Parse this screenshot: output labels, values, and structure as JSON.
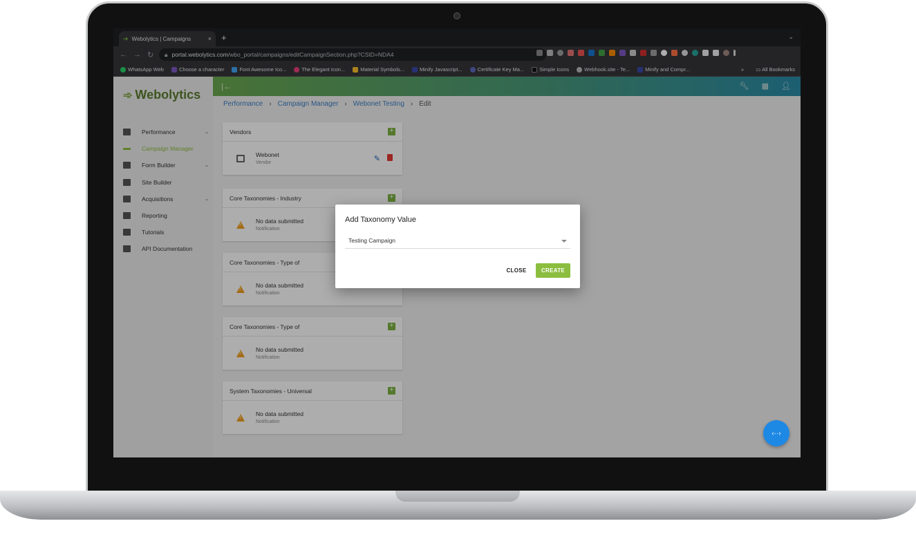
{
  "browser": {
    "tab_title": "Webolytics | Campaigns",
    "tab_close": "×",
    "new_tab": "+",
    "url_host": "portal.webolytics.com",
    "url_path": "/wbo_portal/campaigns/editCampaignSection.php?CSID=NDA4",
    "bookmarks": [
      "WhatsApp Web",
      "Choose a character",
      "Font Awesome Ico...",
      "The Elegant Icon...",
      "Material Symbols...",
      "Minify Javascript...",
      "Certificate Key Ma...",
      "Simple Icons",
      "Webhook.site - Te...",
      "Minify and Compr..."
    ],
    "all_bookmarks": "All Bookmarks",
    "bookmark_more": "»"
  },
  "app": {
    "logo": "Webolytics",
    "menu": [
      {
        "label": "Performance",
        "has_chevron": true,
        "active": false
      },
      {
        "label": "Campaign Manager",
        "has_chevron": false,
        "active": true
      },
      {
        "label": "Form Builder",
        "has_chevron": true,
        "active": false
      },
      {
        "label": "Site Builder",
        "has_chevron": false,
        "active": false
      },
      {
        "label": "Acquisitions",
        "has_chevron": true,
        "active": false
      },
      {
        "label": "Reporting",
        "has_chevron": false,
        "active": false
      },
      {
        "label": "Tutorials",
        "has_chevron": false,
        "active": false
      },
      {
        "label": "API Documentation",
        "has_chevron": false,
        "active": false
      }
    ],
    "breadcrumb": [
      "Performance",
      "Campaign Manager",
      "Webonet Testing",
      "Edit"
    ],
    "cards": [
      {
        "title": "Vendors",
        "row_title": "Webonet",
        "row_sub": "Vendor"
      },
      {
        "title": "Core Taxonomies - Industry",
        "row_title": "No data submitted",
        "row_sub": "Notification"
      },
      {
        "title": "Core Taxonomies - Type of",
        "row_title": "No data submitted",
        "row_sub": "Notification"
      },
      {
        "title": "Core Taxonomies - Type of",
        "row_title": "No data submitted",
        "row_sub": "Notification"
      },
      {
        "title": "System Taxonomies - Universal",
        "row_title": "No data submitted",
        "row_sub": "Notification"
      }
    ]
  },
  "dialog": {
    "title": "Add Taxonomy Value",
    "select_value": "Testing Campaign",
    "close_label": "CLOSE",
    "create_label": "CREATE"
  },
  "colors": {
    "accent": "#8bbd3f",
    "link": "#3b7fc4",
    "fab": "#1e88e5",
    "warning": "#f0a020"
  }
}
